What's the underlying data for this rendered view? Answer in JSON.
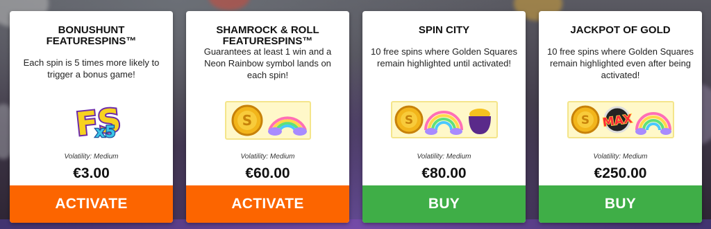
{
  "offers": [
    {
      "title": "BONUSHUNT FEATURESPINS™",
      "description": "Each spin is 5 times more likely to trigger a bonus game!",
      "icon": "fs-x5-badge-icon",
      "volatility": "Volatility: Medium",
      "price": "€3.00",
      "action": "ACTIVATE",
      "badge_text": "FS",
      "badge_multiplier": "x5"
    },
    {
      "title": "SHAMROCK & ROLL FEATURESPINS™",
      "description": "Guarantees at least 1 win and a Neon Rainbow symbol lands on each spin!",
      "icon": "coin-rainbow-symbols-icon",
      "volatility": "Volatility: Medium",
      "price": "€60.00",
      "action": "ACTIVATE"
    },
    {
      "title": "SPIN CITY",
      "description": "10 free spins where Golden Squares remain highlighted until activated!",
      "icon": "coin-rainbow-pot-symbols-icon",
      "volatility": "Volatility: Medium",
      "price": "€80.00",
      "action": "BUY"
    },
    {
      "title": "JACKPOT OF GOLD",
      "description": "10 free spins where Golden Squares remain highlighted even after being activated!",
      "icon": "coin-max-rainbow-symbols-icon",
      "volatility": "Volatility: Medium",
      "price": "€250.00",
      "action": "BUY",
      "badge_text": "MAX"
    }
  ],
  "colors": {
    "activate": "#fc6500",
    "buy": "#3fae47",
    "card": "#ffffff"
  }
}
